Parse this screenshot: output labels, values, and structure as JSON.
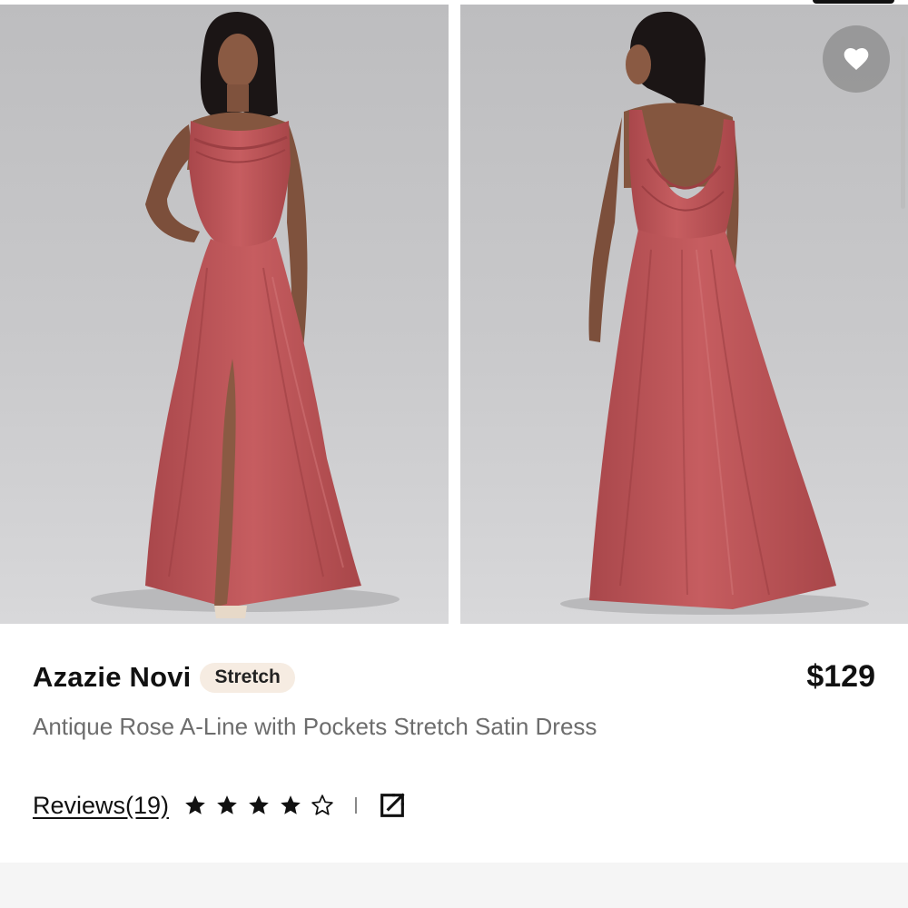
{
  "product": {
    "brand": "Azazie Novi",
    "tag": "Stretch",
    "price": "$129",
    "description": "Antique Rose A-Line with Pockets Stretch Satin Dress"
  },
  "reviews": {
    "label": "Reviews(19)",
    "rating": 4,
    "max_rating": 5
  },
  "icons": {
    "favorite": "heart-icon",
    "share": "external-link-icon",
    "star": "star-icon"
  },
  "colors": {
    "dress": "#c35a5d",
    "backdrop": "#c6c6c8",
    "favorite_bg": "#8a8a8a"
  }
}
